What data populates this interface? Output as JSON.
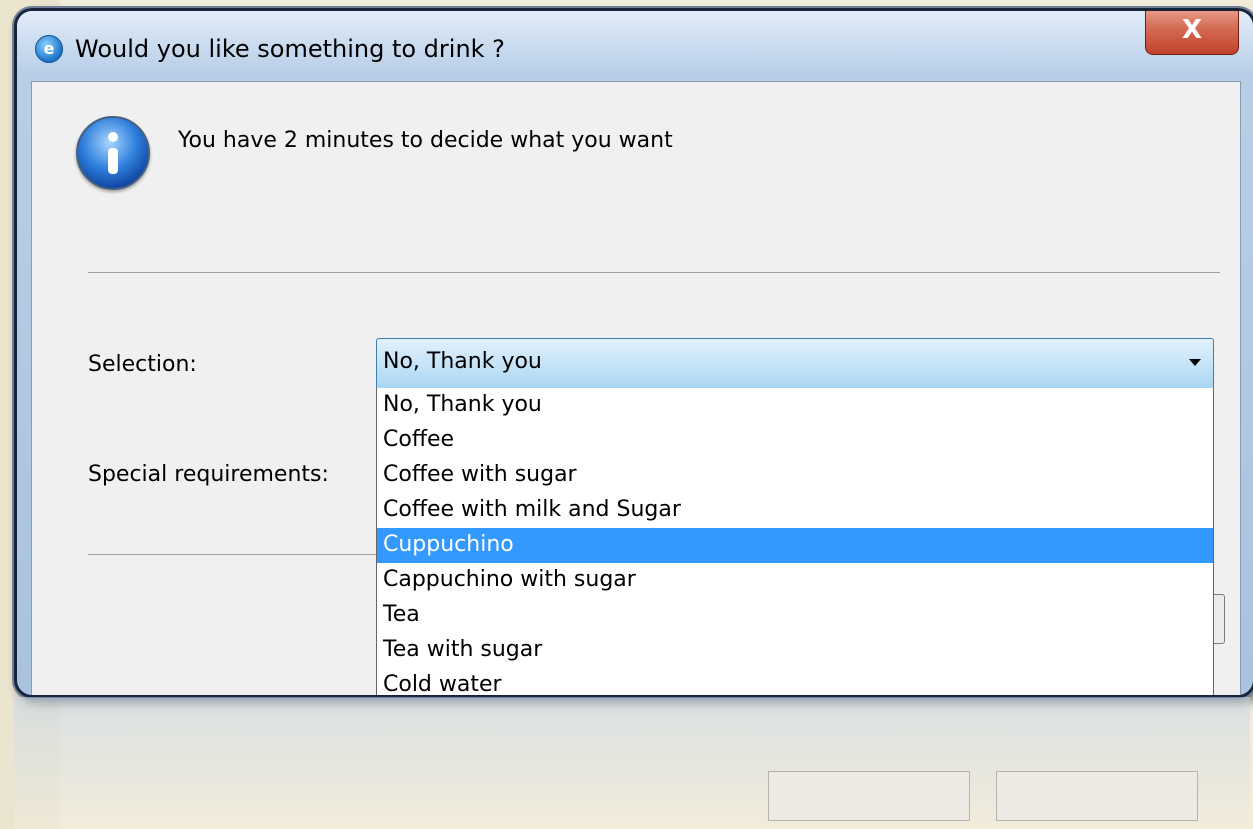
{
  "window": {
    "title": "Would you like something to drink ?",
    "close_label": "X"
  },
  "dialog": {
    "message": "You have 2 minutes to decide what you want",
    "selection_label": "Selection:",
    "special_label": "Special requirements:"
  },
  "select": {
    "value": "No, Thank you",
    "options": [
      "No, Thank you",
      "Coffee",
      "Coffee with sugar",
      "Coffee with milk and Sugar",
      "Cuppuchino",
      "Cappuchino with sugar",
      "Tea",
      "Tea with sugar",
      "Cold water"
    ],
    "selected_option": "Cuppuchino"
  },
  "colors": {
    "highlight": "#3399ff",
    "close_red": "#c2412a",
    "frame": "#16233a"
  },
  "icons": {
    "app": "app-logo-icon",
    "info": "info-icon",
    "dropdown": "chevron-down-icon"
  }
}
